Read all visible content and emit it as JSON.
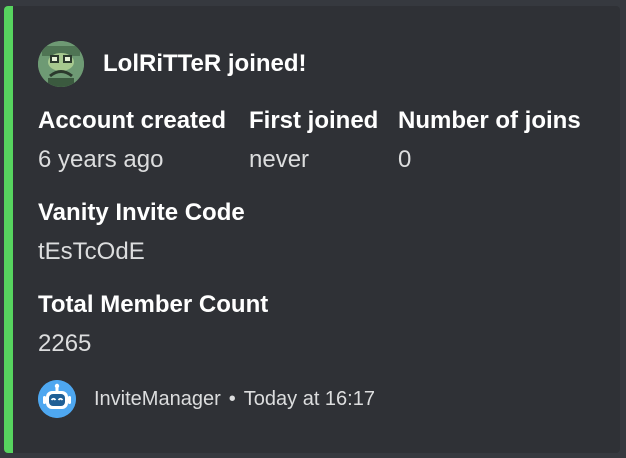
{
  "embed": {
    "accent_color": "#57d45f",
    "author": {
      "name": "LolRiTTeR joined!",
      "avatar_icon": "green-character-avatar"
    },
    "fields": [
      {
        "name": "Account created",
        "value": "6 years ago"
      },
      {
        "name": "First joined",
        "value": "never"
      },
      {
        "name": "Number of joins",
        "value": "0"
      },
      {
        "name": "Vanity Invite Code",
        "value": "tEsTcOdE"
      },
      {
        "name": "Total Member Count",
        "value": "2265"
      }
    ],
    "footer": {
      "bot_name": "InviteManager",
      "separator": "•",
      "timestamp": "Today at 16:17",
      "bot_icon": "robot-icon"
    }
  }
}
